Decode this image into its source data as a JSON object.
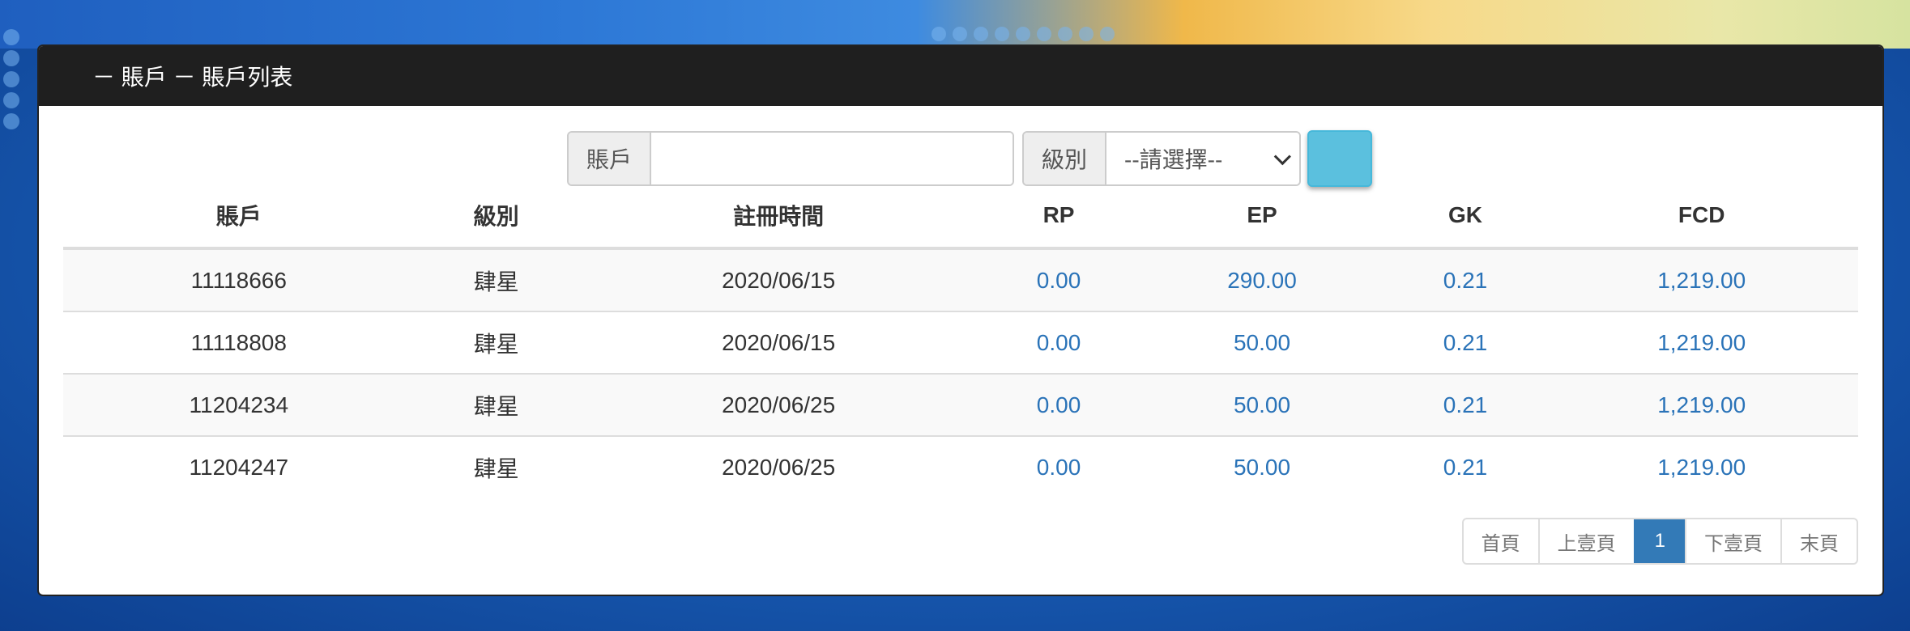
{
  "header": {
    "title": "－ 賬戶 － 賬戶列表"
  },
  "search": {
    "account_label": "賬戶",
    "account_value": "",
    "level_label": "級別",
    "level_selected": "--請選擇--"
  },
  "table": {
    "columns": [
      "賬戶",
      "級別",
      "註冊時間",
      "RP",
      "EP",
      "GK",
      "FCD"
    ],
    "rows": [
      [
        "11118666",
        "肆星",
        "2020/06/15",
        "0.00",
        "290.00",
        "0.21",
        "1,219.00"
      ],
      [
        "11118808",
        "肆星",
        "2020/06/15",
        "0.00",
        "50.00",
        "0.21",
        "1,219.00"
      ],
      [
        "11204234",
        "肆星",
        "2020/06/25",
        "0.00",
        "50.00",
        "0.21",
        "1,219.00"
      ],
      [
        "11204247",
        "肆星",
        "2020/06/25",
        "0.00",
        "50.00",
        "0.21",
        "1,219.00"
      ]
    ]
  },
  "pagination": {
    "first": "首頁",
    "prev": "上壹頁",
    "current": "1",
    "next": "下壹頁",
    "last": "末頁"
  },
  "colors": {
    "header_bg": "#1f1f1f",
    "link": "#2a73b8",
    "search_button": "#5bc0de",
    "page_active": "#337ab7"
  }
}
